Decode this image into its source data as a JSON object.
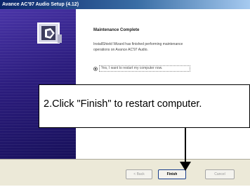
{
  "window": {
    "title": "Avance AC'97 Audio Setup (4.12)"
  },
  "dialog": {
    "heading": "Maintenance Complete",
    "body": "InstallShield Wizard has finished performing maintenance operations on Avance AC'97 Audio.",
    "option_label": "Yes, I want to restart my computer now."
  },
  "buttons": {
    "back_label": "< Back",
    "finish_label": "Finish",
    "cancel_label": "Cancel"
  },
  "callout": {
    "text": "2.Click \"Finish\" to restart computer."
  },
  "icons": {
    "banner_icon": "install-box-icon",
    "arrow": "down-arrow-icon"
  },
  "colors": {
    "banner": "#2c1d7e",
    "titlebar": "#0a246a"
  }
}
